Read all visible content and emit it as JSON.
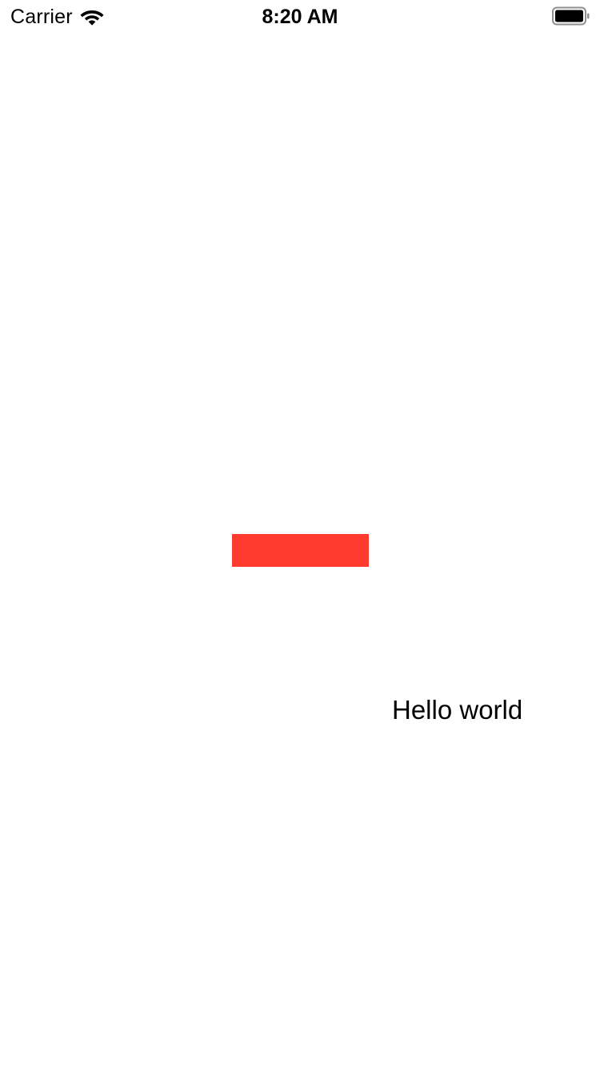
{
  "status_bar": {
    "carrier": "Carrier",
    "time": "8:20 AM",
    "icons": [
      "wifi-icon",
      "battery-icon"
    ]
  },
  "content": {
    "red_box_color": "#ff3b30",
    "label": "Hello world"
  }
}
